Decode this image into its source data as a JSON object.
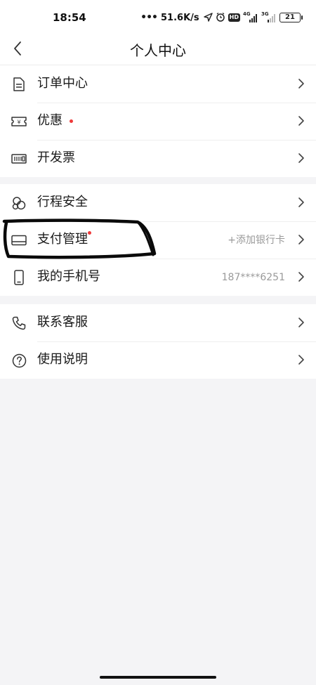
{
  "status_bar": {
    "time": "18:54",
    "dots": "•••",
    "network_speed": "51.6K/s",
    "hd_label": "HD",
    "net_4g": "4G",
    "net_3g": "3G",
    "battery": "21"
  },
  "nav": {
    "title": "个人中心"
  },
  "groups": [
    {
      "items": [
        {
          "label": "订单中心",
          "icon": "document-icon",
          "has_dot": false
        },
        {
          "label": "优惠",
          "icon": "coupon-icon",
          "has_dot": true
        },
        {
          "label": "开发票",
          "icon": "invoice-icon",
          "has_dot": false
        }
      ]
    },
    {
      "items": [
        {
          "label": "行程安全",
          "icon": "shield-people-icon",
          "has_dot": false
        },
        {
          "label": "支付管理",
          "icon": "wallet-card-icon",
          "has_dot": true,
          "value": "+添加银行卡"
        },
        {
          "label": "我的手机号",
          "icon": "phone-icon",
          "has_dot": false,
          "value": "187****6251"
        }
      ]
    },
    {
      "items": [
        {
          "label": "联系客服",
          "icon": "telephone-icon",
          "has_dot": false
        },
        {
          "label": "使用说明",
          "icon": "help-icon",
          "has_dot": false
        }
      ]
    }
  ],
  "colors": {
    "background": "#f4f4f6",
    "dot": "#ee3a3a",
    "secondary_text": "#9a9a9a"
  }
}
